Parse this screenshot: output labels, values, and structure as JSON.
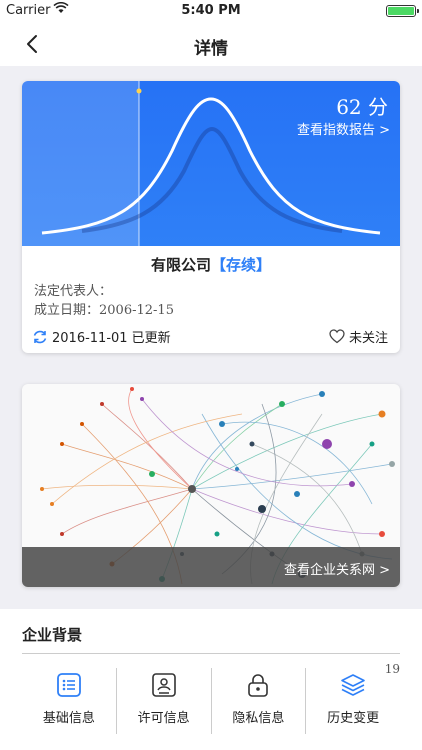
{
  "status_bar": {
    "carrier": "Carrier",
    "time": "5:40 PM"
  },
  "nav": {
    "title": "详情"
  },
  "score_card": {
    "score": "62 分",
    "report_link": "查看指数报告 >",
    "company_name": "有限公司",
    "company_status": "【存续】",
    "legal_rep_label": "法定代表人：",
    "established_label": "成立日期：",
    "established_date": "2006-12-15",
    "updated": "2016-11-01 已更新",
    "follow": "未关注"
  },
  "network_card": {
    "link": "查看企业关系网 >"
  },
  "background": {
    "title": "企业背景",
    "badge": "19",
    "items": [
      {
        "label": "基础信息",
        "icon": "list-icon"
      },
      {
        "label": "许可信息",
        "icon": "license-icon"
      },
      {
        "label": "隐私信息",
        "icon": "lock-icon"
      },
      {
        "label": "历史变更",
        "icon": "layers-icon"
      }
    ]
  },
  "colors": {
    "accent": "#2f80f7",
    "chart_bg": "#2672f5"
  }
}
